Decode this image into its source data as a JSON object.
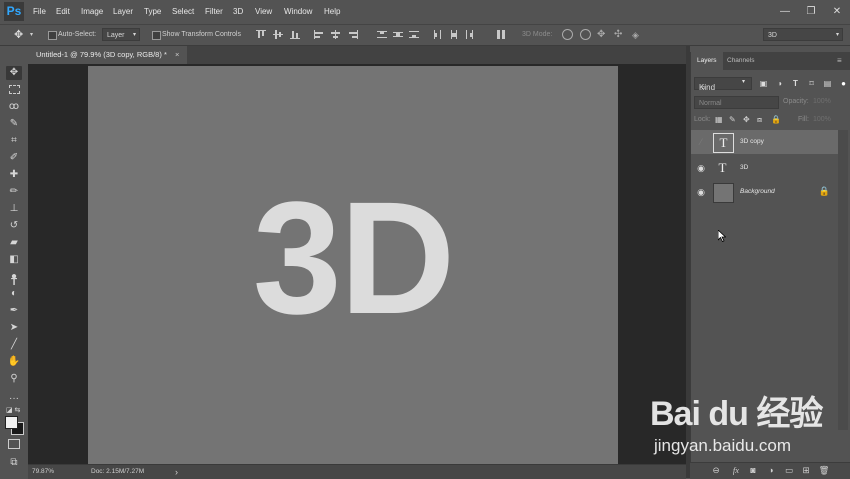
{
  "app": {
    "logo": "Ps",
    "accent": "#31a8ff"
  },
  "menu": [
    "File",
    "Edit",
    "Image",
    "Layer",
    "Type",
    "Select",
    "Filter",
    "3D",
    "View",
    "Window",
    "Help"
  ],
  "window_controls": {
    "minimize": "—",
    "restore": "❐",
    "close": "✕"
  },
  "options": {
    "auto_select_label": "Auto-Select:",
    "auto_select_value": "Layer",
    "show_transform_label": "Show Transform Controls",
    "mode_3d_label": "3D Mode:",
    "workspace_value": "3D"
  },
  "document": {
    "tab_title": "Untitled-1 @ 79.9% (3D copy, RGB/8) *",
    "tab_close": "×",
    "canvas_text": "3D",
    "status_zoom": "79.87%",
    "status_doc": "Doc: 2.15M/7.27M",
    "status_arrow": "›"
  },
  "panel": {
    "tabs": [
      "Layers",
      "Channels"
    ],
    "kind_label": "Kind",
    "blend_mode": "Normal",
    "opacity_label": "Opacity:",
    "opacity_value": "100%",
    "lock_label": "Lock:",
    "fill_label": "Fill:",
    "fill_value": "100%",
    "layers": [
      {
        "name": "3D copy",
        "type": "text",
        "visible": false,
        "selected": true
      },
      {
        "name": "3D",
        "type": "text",
        "visible": true,
        "selected": false
      },
      {
        "name": "Background",
        "type": "pixel",
        "visible": true,
        "selected": false,
        "locked": true
      }
    ]
  },
  "watermark": {
    "brand": "Bai du 经验",
    "url": "jingyan.baidu.com"
  }
}
